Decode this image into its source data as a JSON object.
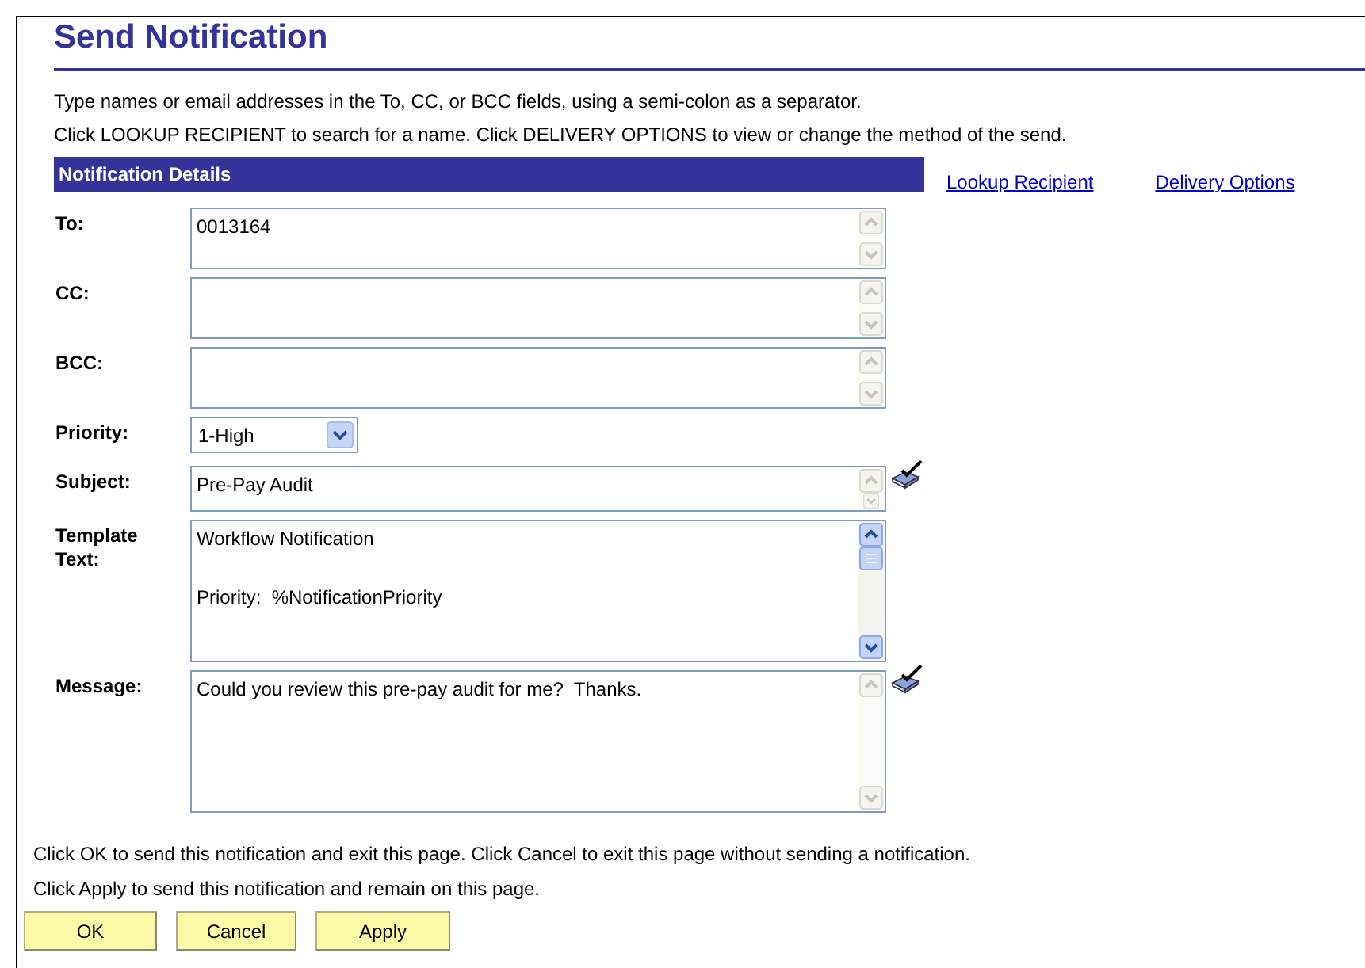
{
  "title": "Send Notification",
  "instructions": [
    "Type names or email addresses in the To, CC, or BCC fields, using a semi-colon as a separator.",
    "Click LOOKUP RECIPIENT to search for a name.  Click DELIVERY OPTIONS to view or change the method of the send."
  ],
  "section_header": "Notification Details",
  "links": [
    "Lookup Recipient",
    "Delivery Options"
  ],
  "fields": [
    {
      "kind": "text",
      "label": "To:",
      "value": "0013164"
    },
    {
      "kind": "text",
      "label": "CC:"
    },
    {
      "kind": "text",
      "label": "BCC:"
    },
    {
      "kind": "select",
      "label": "Priority:",
      "value": "1-High"
    },
    {
      "kind": "short",
      "label": "Subject:",
      "value": "Pre-Pay Audit",
      "spellcheck": true
    },
    {
      "kind": "memo",
      "label": "Template Text:",
      "value": "Workflow Notification\n\nPriority:  %NotificationPriority",
      "scrollable": true
    },
    {
      "kind": "memo",
      "label": "Message:",
      "value": "Could you review this pre-pay audit for me?  Thanks.",
      "spellcheck": true
    }
  ],
  "footer_text": [
    "Click OK to send this notification and exit this page.  Click Cancel to exit this page without sending a notification.",
    "Click Apply to send this notification and remain on this page."
  ],
  "buttons": [
    "OK",
    "Cancel",
    "Apply"
  ]
}
